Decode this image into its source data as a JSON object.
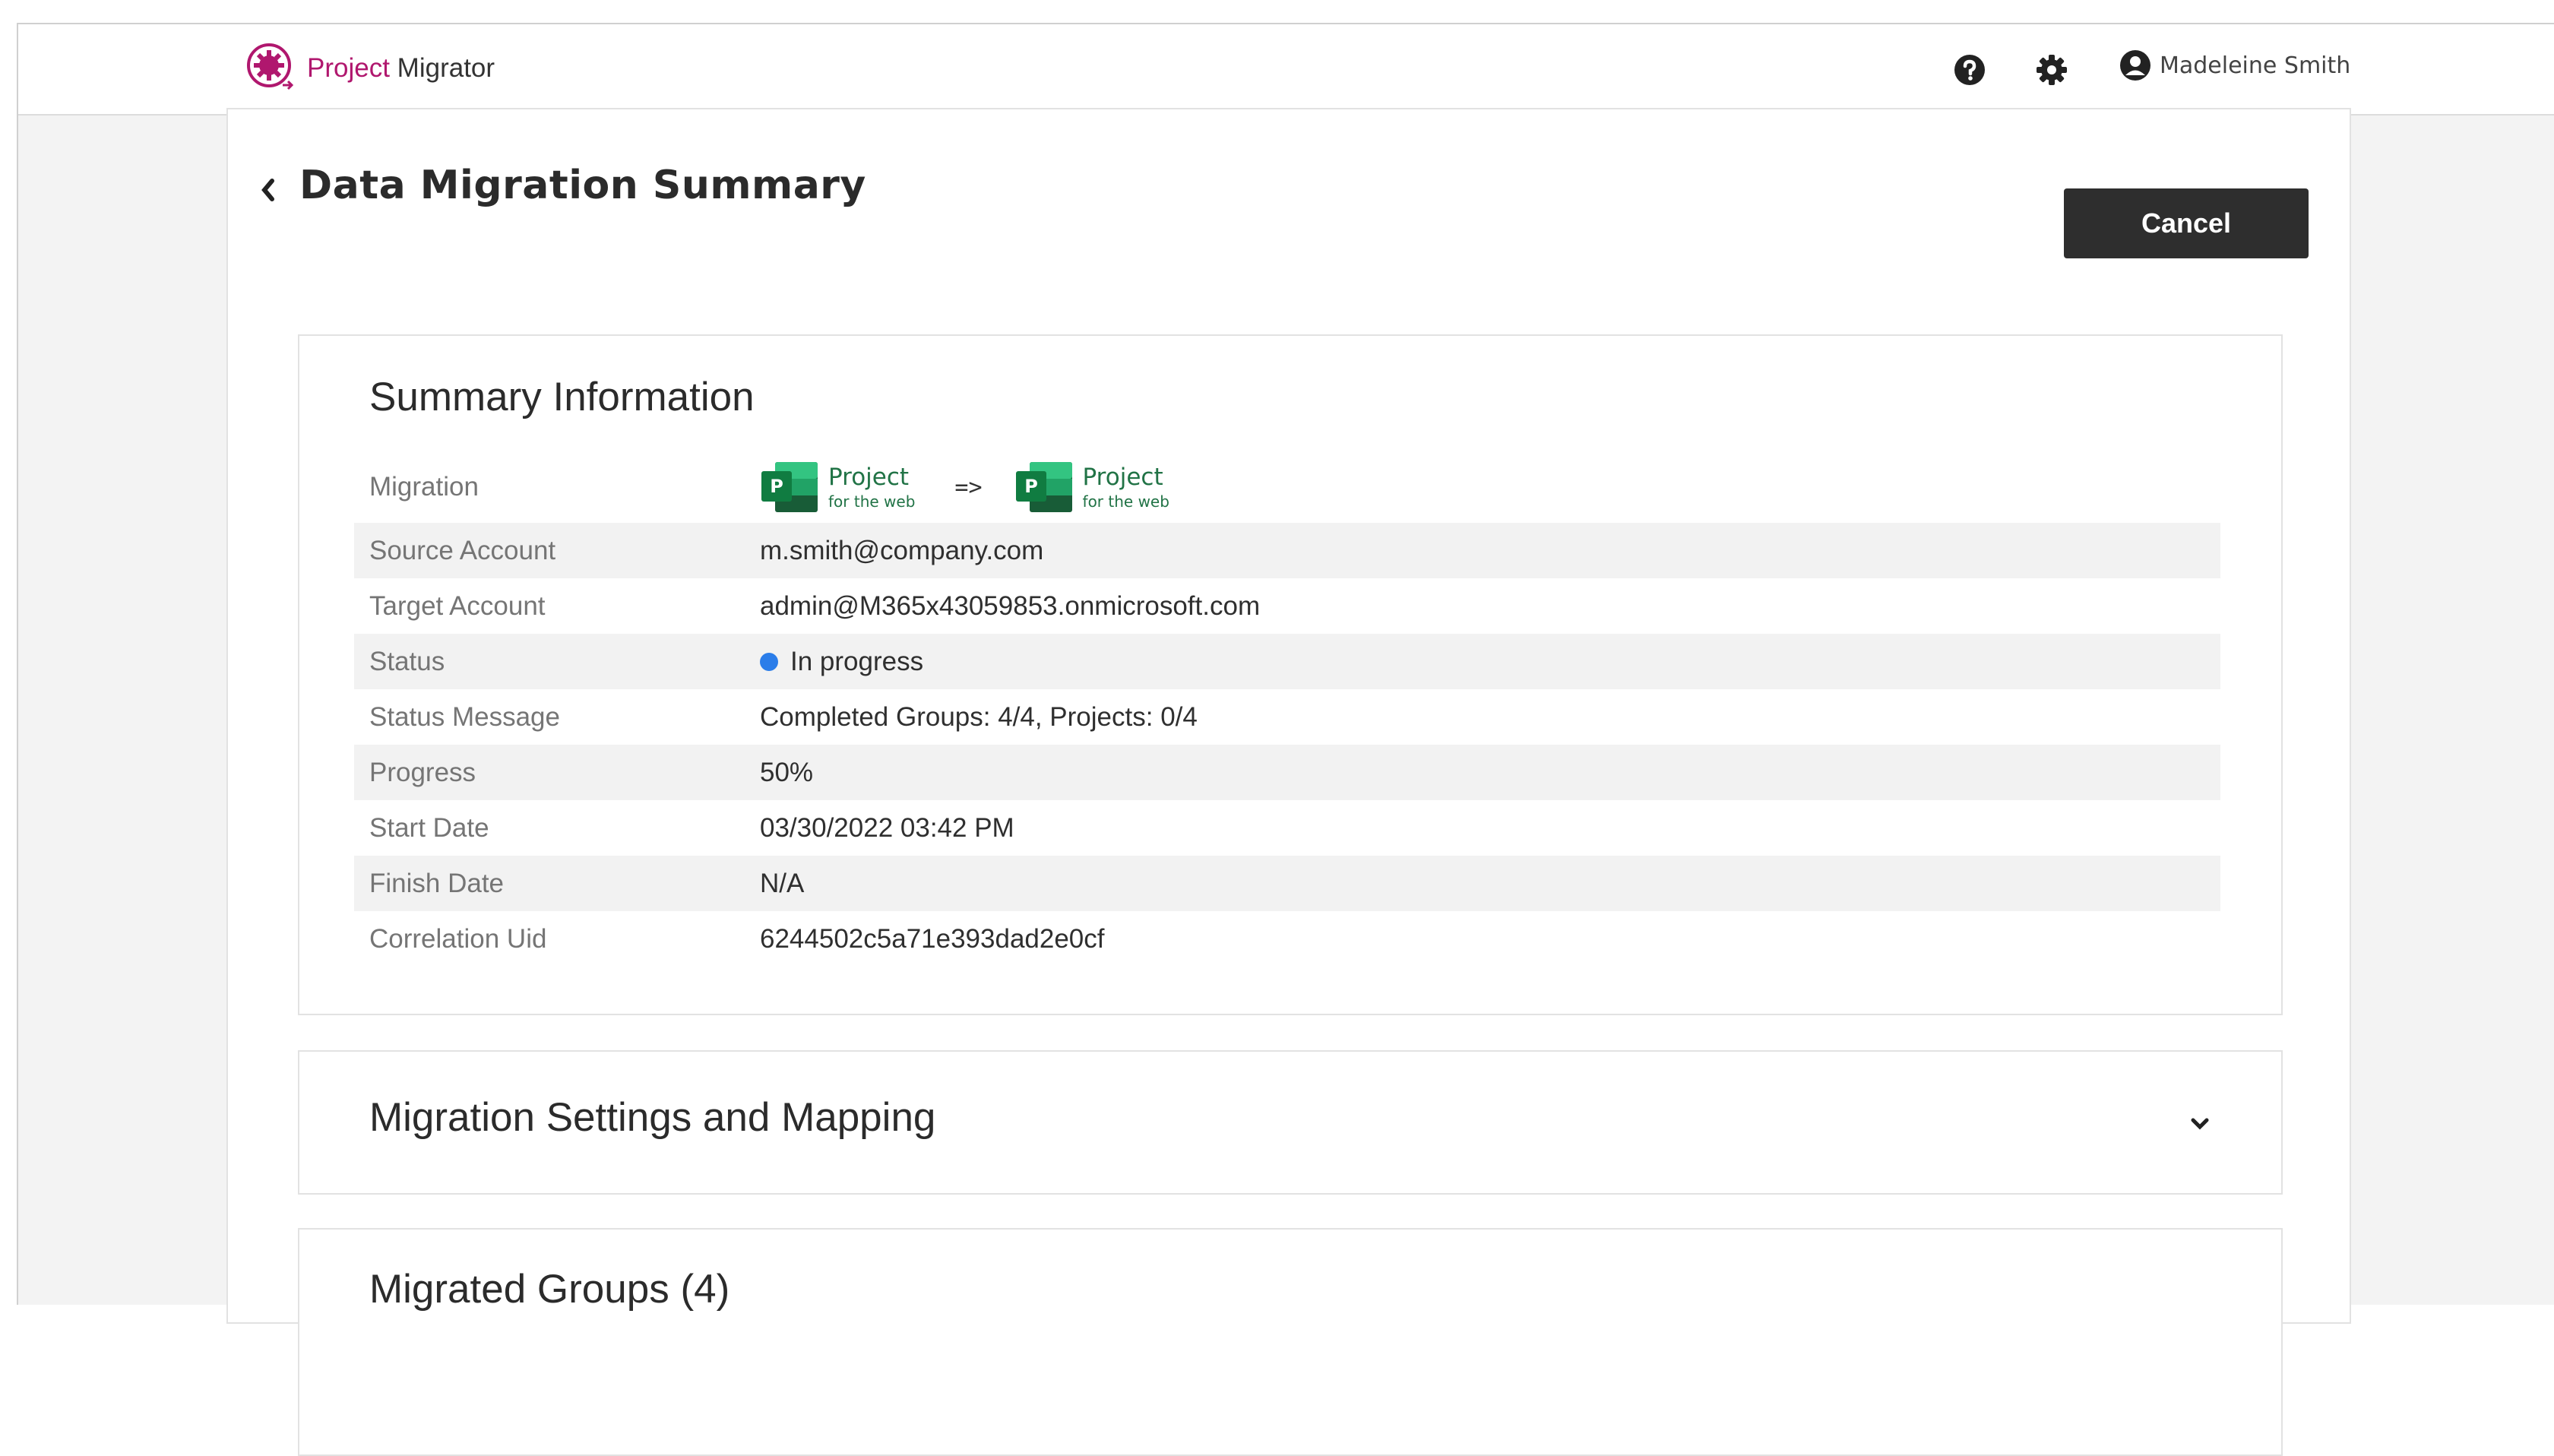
{
  "app": {
    "brand_part1": "Project",
    "brand_part2": "Migrator",
    "brand_color": "#b0176e"
  },
  "header": {
    "icons": [
      "help-icon",
      "gear-icon",
      "user-circle-icon"
    ],
    "user_name": "Madeleine Smith"
  },
  "page": {
    "title": "Data Migration Summary",
    "cancel_label": "Cancel"
  },
  "summary": {
    "title": "Summary Information",
    "migration": {
      "label": "Migration",
      "source_product": {
        "name": "Project",
        "sub": "for the web"
      },
      "arrow": "=>",
      "target_product": {
        "name": "Project",
        "sub": "for the web"
      }
    },
    "rows": [
      {
        "label": "Source Account",
        "value": "m.smith@company.com"
      },
      {
        "label": "Target Account",
        "value": "admin@M365x43059853.onmicrosoft.com"
      },
      {
        "label": "Status",
        "value": "In progress",
        "status_color": "#2b7de9"
      },
      {
        "label": "Status Message",
        "value": "Completed Groups: 4/4, Projects: 0/4"
      },
      {
        "label": "Progress",
        "value": "50%"
      },
      {
        "label": "Start Date",
        "value": "03/30/2022 03:42 PM"
      },
      {
        "label": "Finish Date",
        "value": "N/A"
      },
      {
        "label": "Correlation Uid",
        "value": "6244502c5a71e393dad2e0cf"
      }
    ]
  },
  "settings_section": {
    "title": "Migration Settings and Mapping"
  },
  "groups_section": {
    "title": "Migrated Groups (4)"
  }
}
